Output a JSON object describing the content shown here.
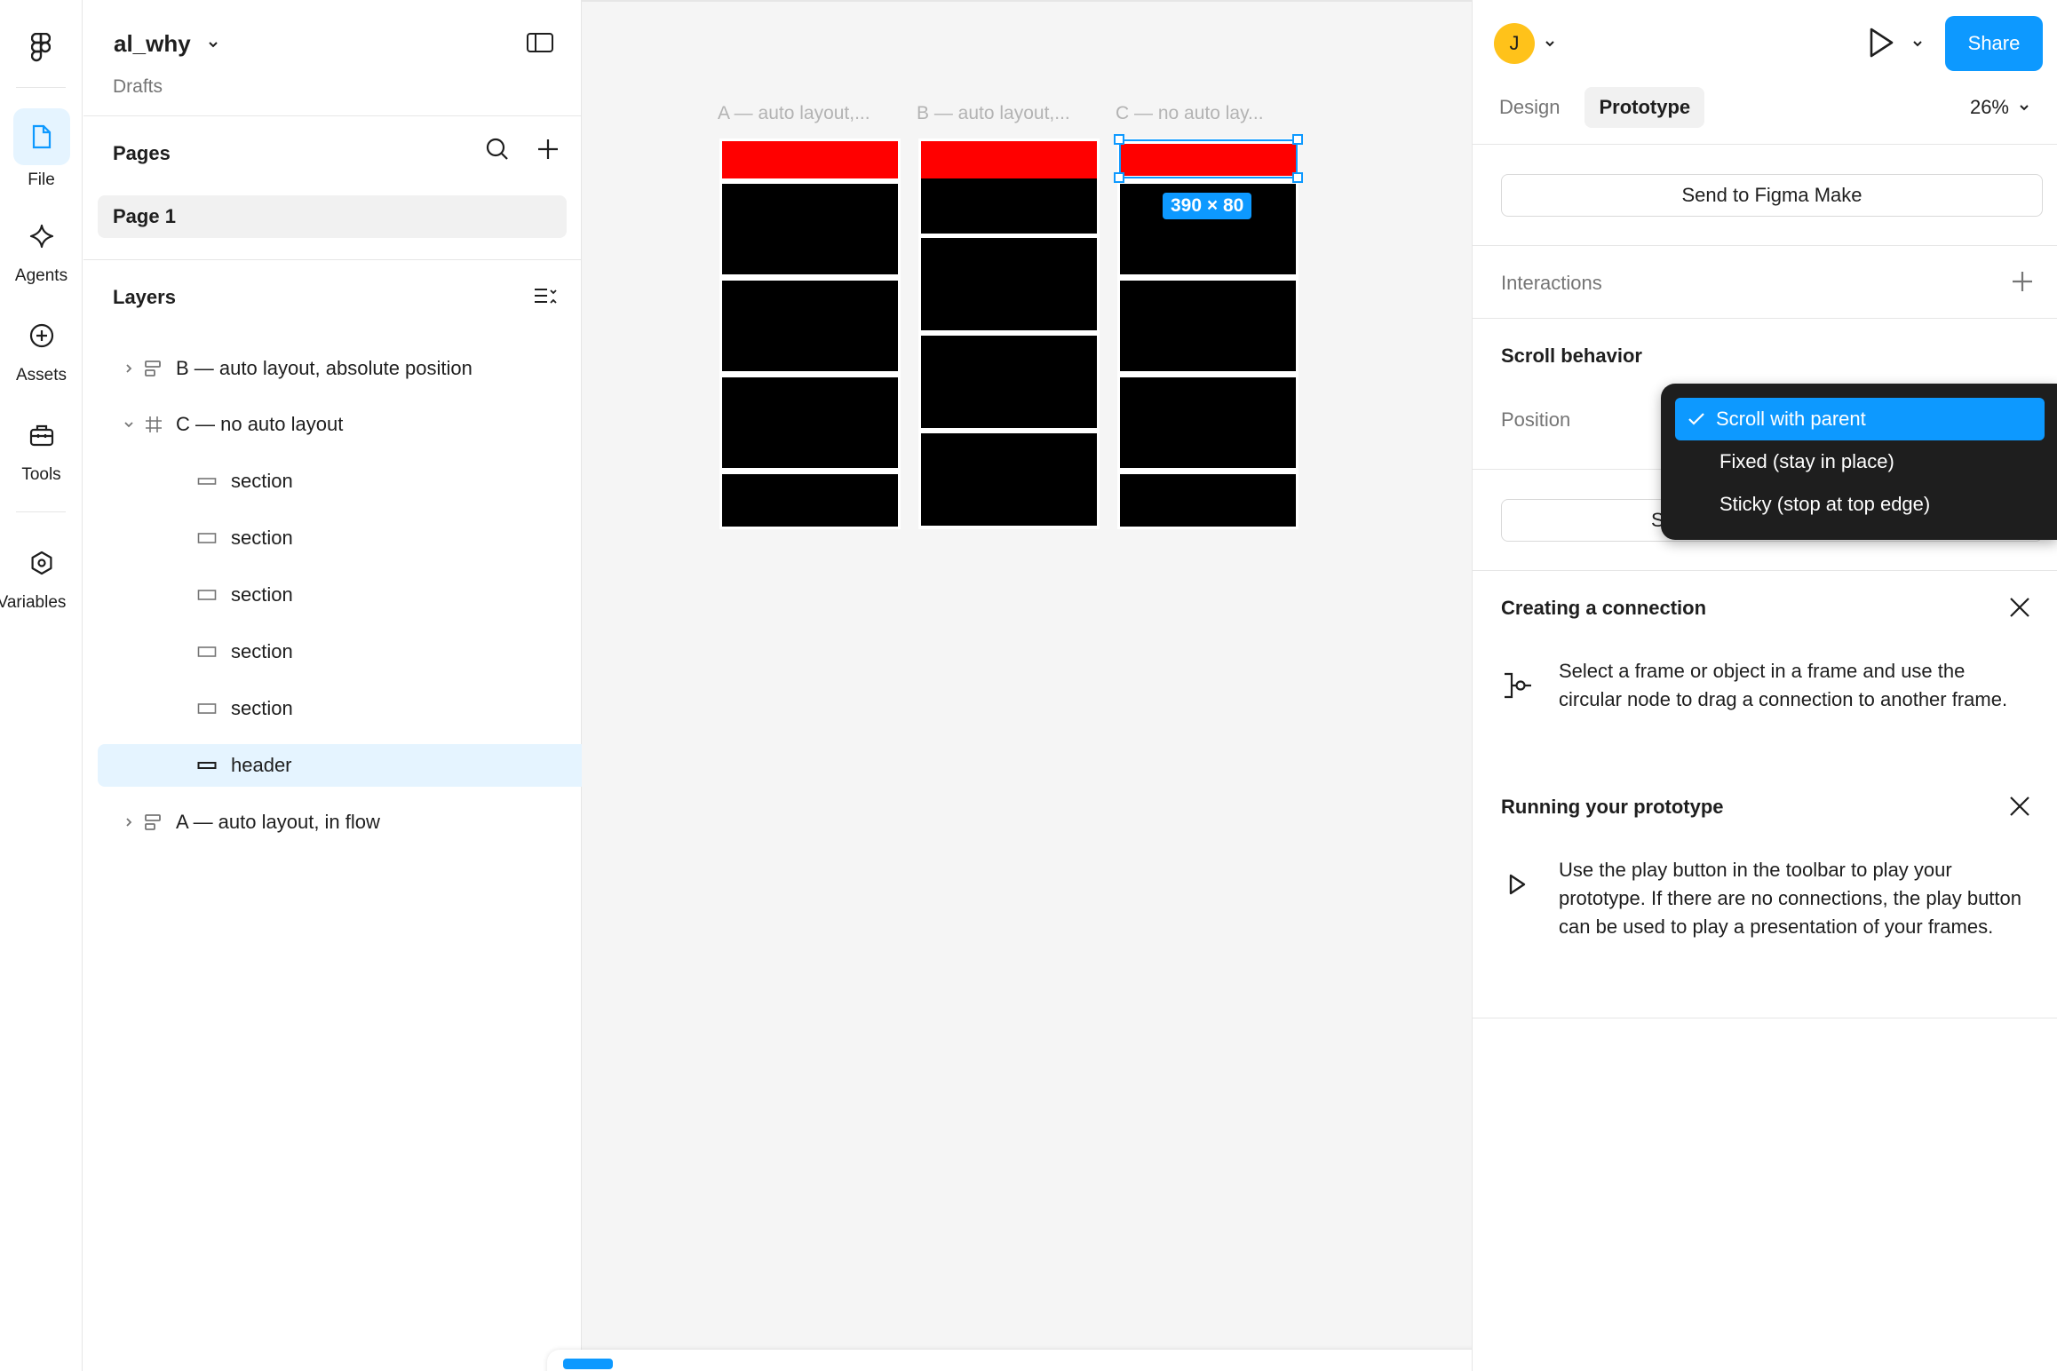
{
  "rail": {
    "items": [
      {
        "label": "File",
        "icon": "file-icon"
      },
      {
        "label": "Agents",
        "icon": "sparkle-icon"
      },
      {
        "label": "Assets",
        "icon": "plus-circle-icon"
      },
      {
        "label": "Tools",
        "icon": "toolbox-icon"
      },
      {
        "label": "Variables",
        "icon": "variables-icon"
      }
    ]
  },
  "file": {
    "name": "al_why",
    "location": "Drafts"
  },
  "pages": {
    "title": "Pages",
    "items": [
      {
        "label": "Page 1"
      }
    ]
  },
  "layers": {
    "title": "Layers",
    "items": [
      {
        "label": "B — auto layout, absolute position"
      },
      {
        "label": "C — no auto layout"
      },
      {
        "label": "section"
      },
      {
        "label": "section"
      },
      {
        "label": "section"
      },
      {
        "label": "section"
      },
      {
        "label": "section"
      },
      {
        "label": "header"
      },
      {
        "label": "A — auto layout, in flow"
      }
    ]
  },
  "canvas": {
    "frames": [
      {
        "label": "A — auto layout,..."
      },
      {
        "label": "B — auto layout,..."
      },
      {
        "label": "C — no auto lay..."
      }
    ],
    "selection_size": "390 × 80"
  },
  "header": {
    "avatar_initial": "J",
    "share_label": "Share"
  },
  "right": {
    "tabs": [
      {
        "label": "Design"
      },
      {
        "label": "Prototype"
      }
    ],
    "zoom": "26%",
    "send_button": "Send to Figma Make",
    "interactions_label": "Interactions",
    "scroll_behavior_title": "Scroll behavior",
    "position_label": "Position",
    "partial_button_text": "S",
    "connection_title": "Creating a connection",
    "connection_text": "Select a frame or object in a frame and use the circular node to drag a connection to another frame.",
    "running_title": "Running your prototype",
    "running_text": "Use the play button in the toolbar to play your prototype. If there are no connections, the play button can be used to play a presentation of your frames."
  },
  "dropdown": {
    "options": [
      {
        "label": "Scroll with parent",
        "selected": true
      },
      {
        "label": "Fixed (stay in place)",
        "selected": false
      },
      {
        "label": "Sticky (stop at top edge)",
        "selected": false
      }
    ]
  },
  "colors": {
    "accent": "#0d99ff",
    "header_fill": "#ff0000",
    "section_fill": "#000000",
    "avatar": "#ffc21a"
  }
}
